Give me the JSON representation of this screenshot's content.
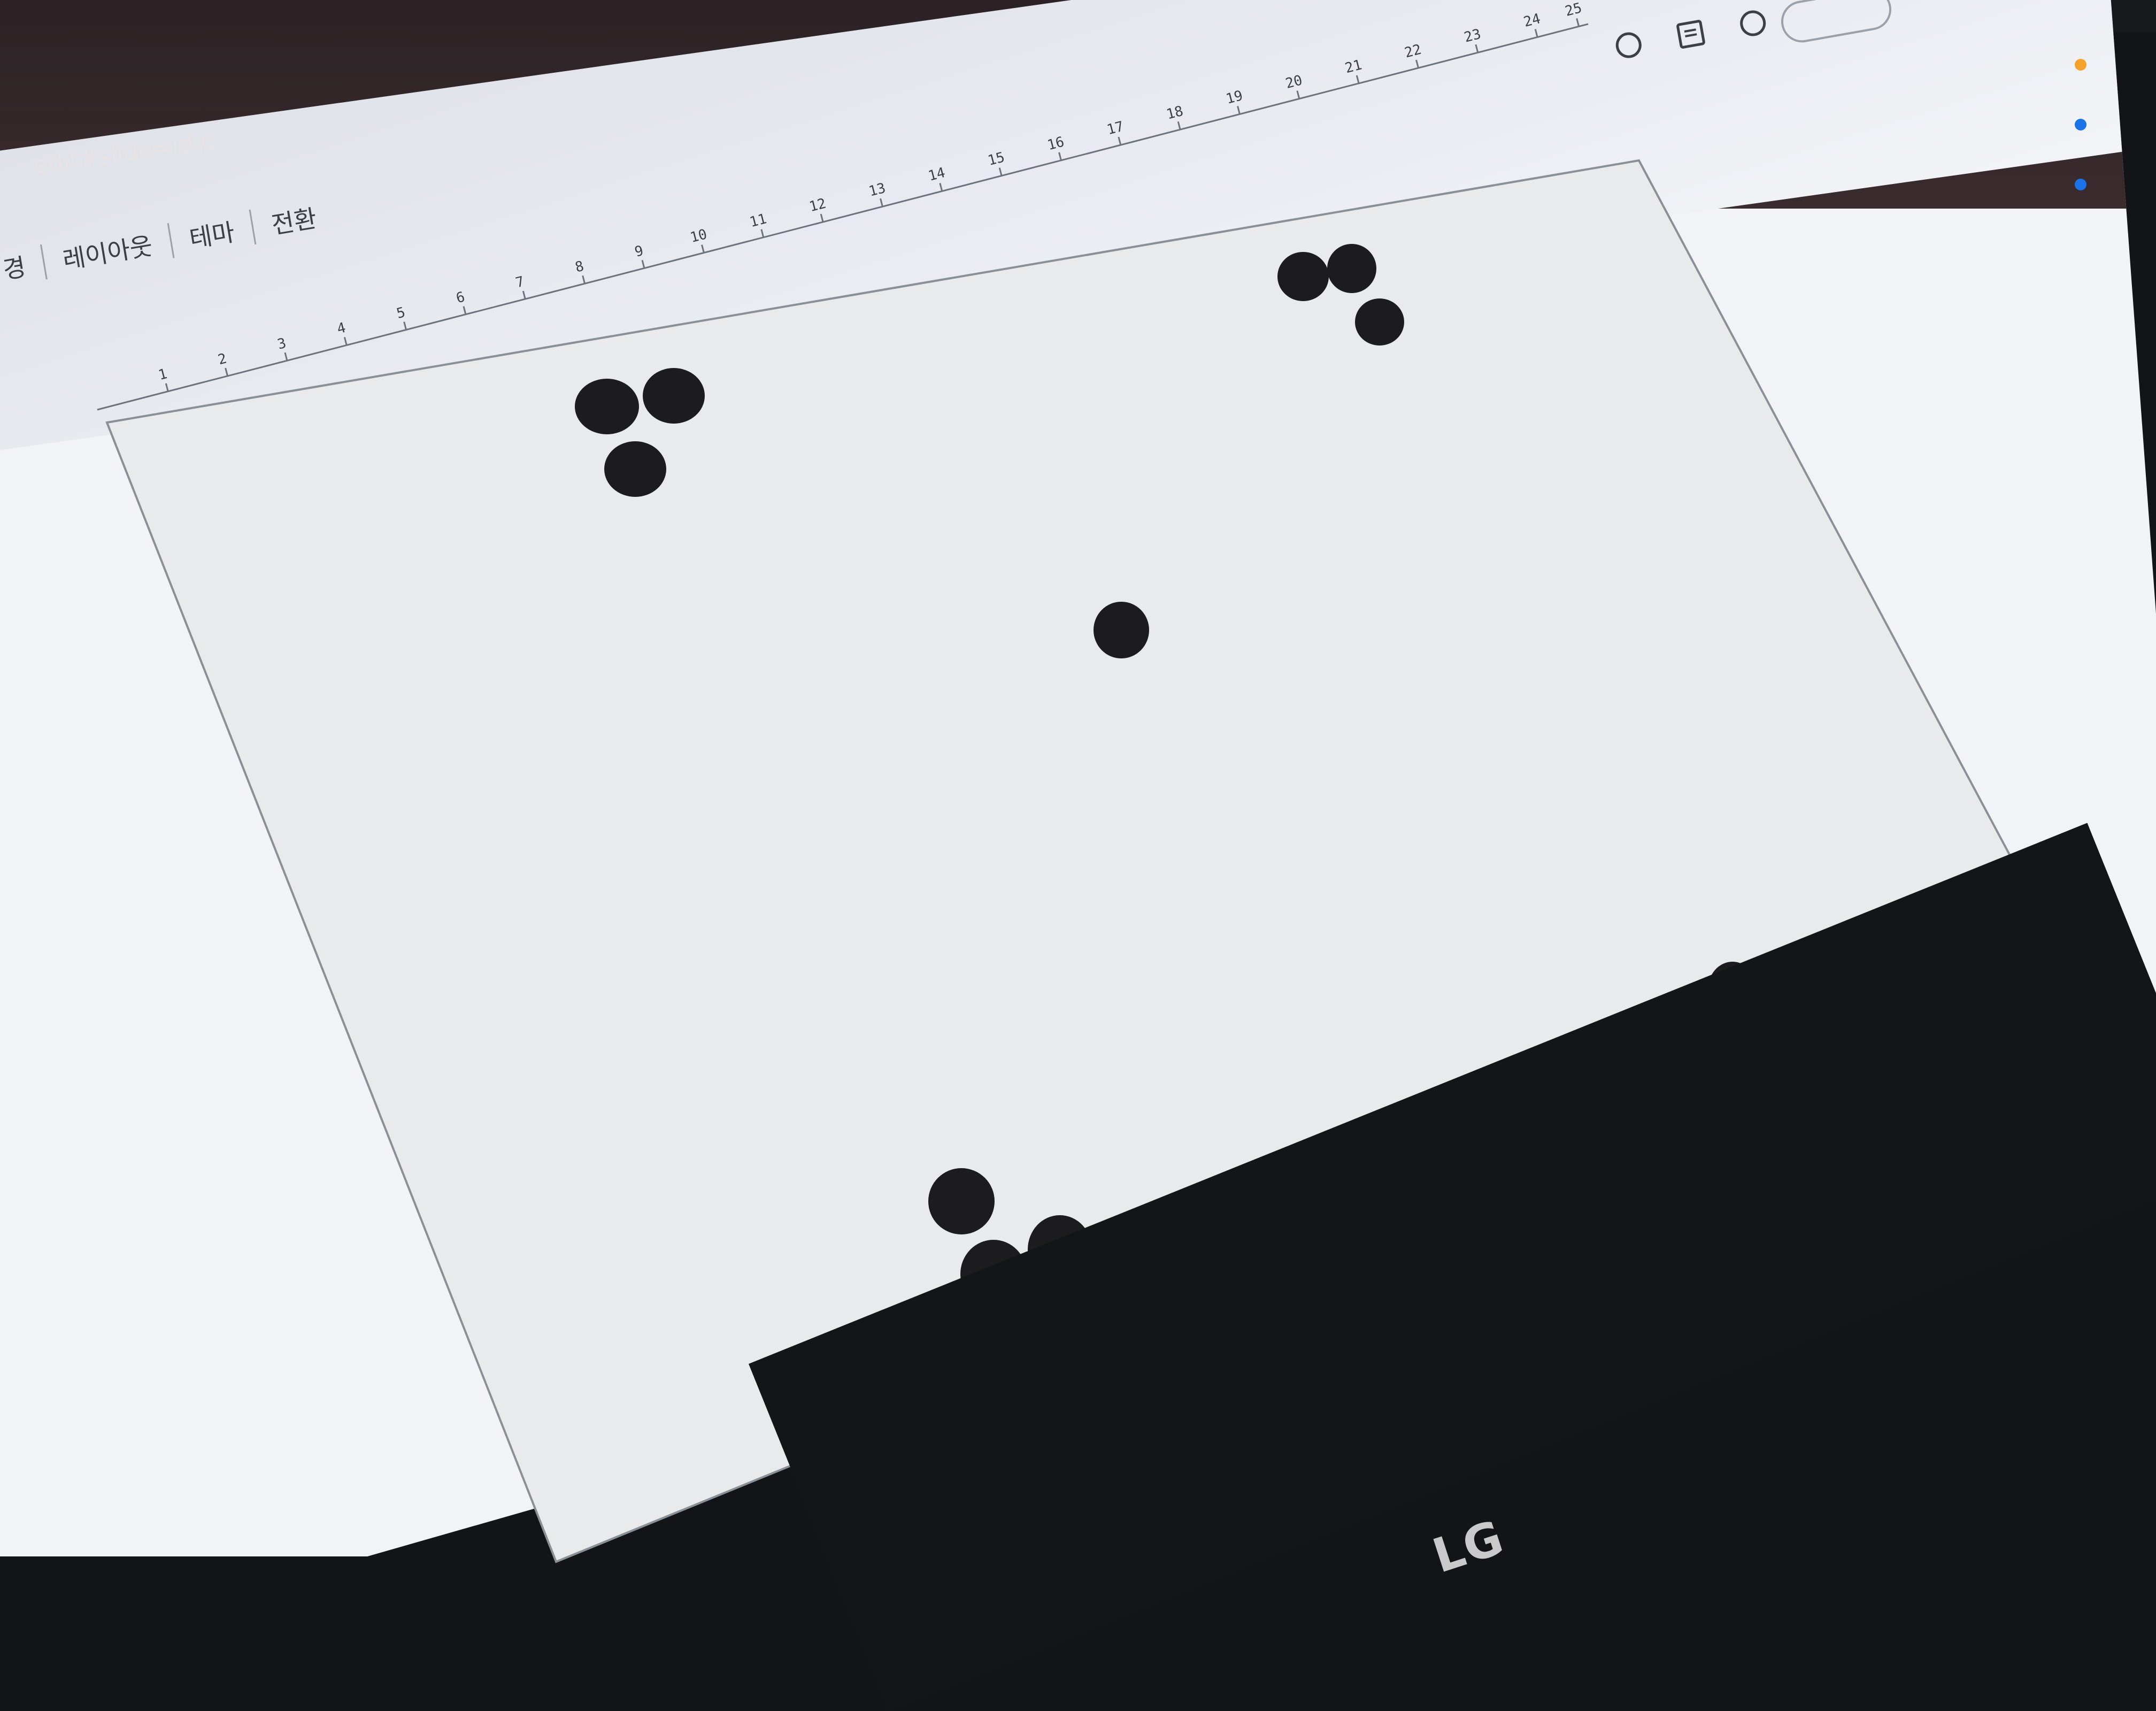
{
  "browser": {
    "url_fragment": "edit#slide=id.p"
  },
  "toolbar": {
    "menu_items": [
      "경",
      "레이아웃",
      "테마",
      "전환"
    ]
  },
  "ruler": {
    "ticks": [
      "1",
      "2",
      "3",
      "4",
      "5",
      "6",
      "7",
      "8",
      "9",
      "10",
      "11",
      "12",
      "13",
      "14",
      "15",
      "16",
      "17",
      "18",
      "19",
      "20",
      "21",
      "22",
      "23",
      "24",
      "25"
    ]
  },
  "monitor": {
    "brand": "LG"
  },
  "colors": {
    "dot": "#1c1c1f",
    "slide_bg": "#e9eaec",
    "slide_border": "#8a9097",
    "accent_blue": "#1a73e8",
    "accent_orange": "#f4a229"
  },
  "icons": [
    "history-icon",
    "comment-icon",
    "camera-icon"
  ]
}
